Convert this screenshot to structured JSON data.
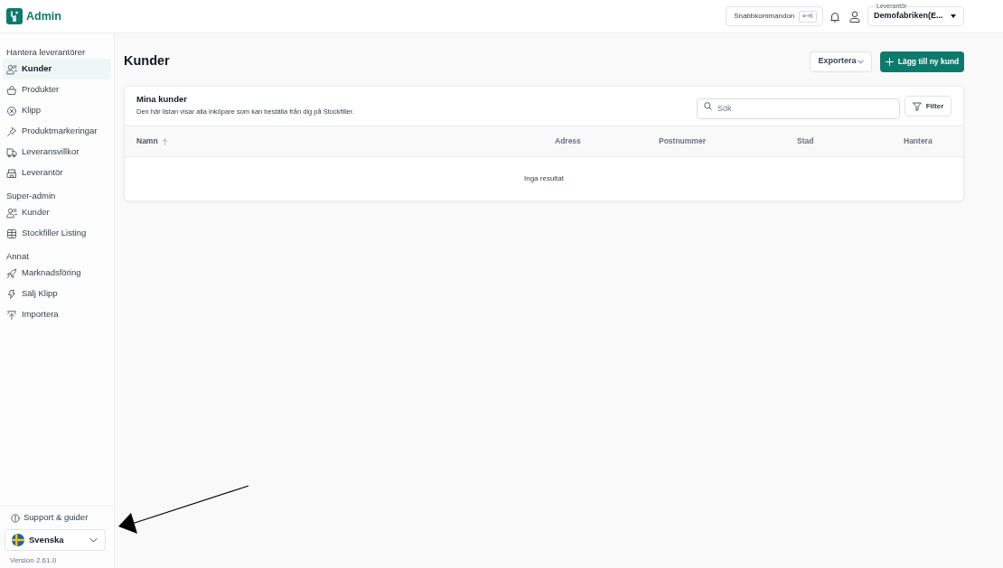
{
  "header": {
    "app_name": "Admin",
    "command_button": {
      "label": "Snabbkommandon",
      "shortcut": "⌘+K"
    },
    "supplier_select": {
      "legend": "Leverantör",
      "value": "Demofabriken(E..."
    }
  },
  "sidebar": {
    "sections": [
      {
        "heading": "Hantera leverantörer",
        "items": [
          {
            "label": "Kunder",
            "selected": true
          },
          {
            "label": "Produkter",
            "selected": false
          },
          {
            "label": "Klipp",
            "selected": false
          },
          {
            "label": "Produktmarkeringar",
            "selected": false
          },
          {
            "label": "Leveransvillkor",
            "selected": false
          },
          {
            "label": "Leverantör",
            "selected": false
          }
        ]
      },
      {
        "heading": "Super-admin",
        "items": [
          {
            "label": "Kunder",
            "selected": false
          },
          {
            "label": "Stockfiller Listing",
            "selected": false
          }
        ]
      },
      {
        "heading": "Annat",
        "items": [
          {
            "label": "Marknadsföring",
            "selected": false
          },
          {
            "label": "Sälj Klipp",
            "selected": false
          },
          {
            "label": "Importera",
            "selected": false
          }
        ]
      }
    ],
    "support_link": "Support & guider",
    "language_select": {
      "value": "Svenska"
    },
    "version": "Version 2.61.0"
  },
  "page": {
    "title": "Kunder",
    "export_button": "Exportera",
    "add_button": "Lägg till ny kund"
  },
  "card": {
    "title": "Mina kunder",
    "description": "Den här listan visar alla inköpare som kan beställa från dig på Stockfiller.",
    "search": {
      "placeholder": "Sök"
    },
    "filter_button": "Filter",
    "table": {
      "columns": [
        {
          "label": "Namn",
          "sorted": true
        },
        {
          "label": "Adress",
          "sorted": false
        },
        {
          "label": "Postnummer",
          "sorted": false
        },
        {
          "label": "Stad",
          "sorted": false
        },
        {
          "label": "Hantera",
          "sorted": false
        }
      ],
      "empty_message": "Inga resultat"
    }
  }
}
